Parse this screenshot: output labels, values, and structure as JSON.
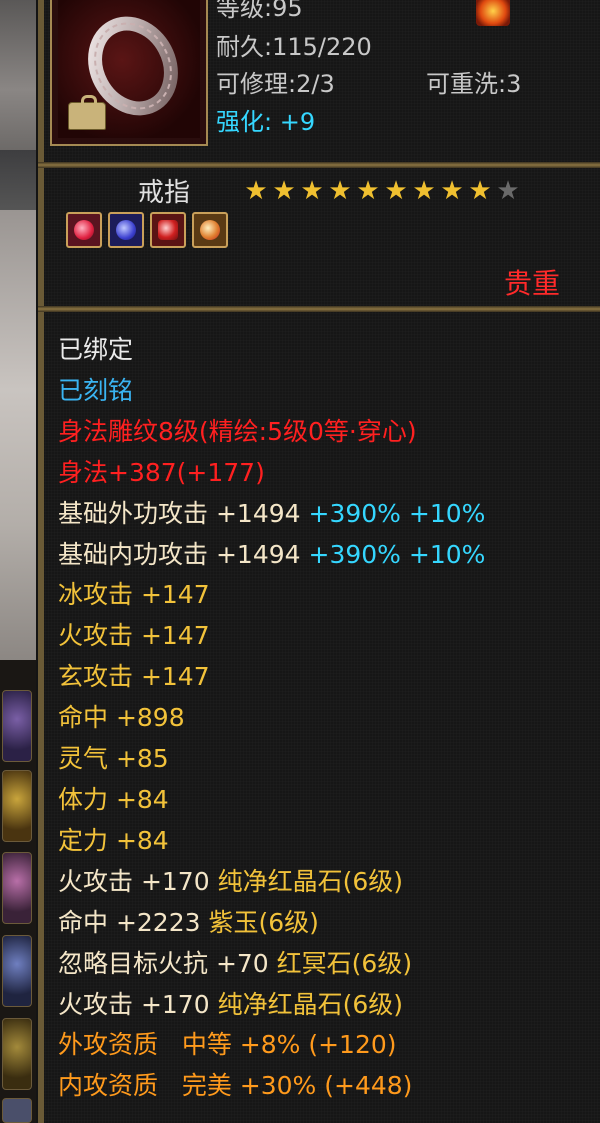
{
  "item": {
    "level_text": "等级:95",
    "durability_text": "耐久:115/220",
    "repairable_text": "可修理:2/3",
    "rewash_text": "可重洗:3",
    "enhance_label": "强化:",
    "enhance_value": "+9",
    "type": "戒指",
    "stars_filled": 9,
    "stars_total": 10,
    "gems": [
      "red",
      "blue",
      "ruby",
      "gold"
    ],
    "rarity": "贵重"
  },
  "colors": {
    "white": "#eaeaea",
    "blue": "#3ab4f2",
    "red": "#ff2020",
    "cream": "#f4e6c8",
    "cyan": "#35d7ff",
    "yellow": "#f2c23a",
    "orange": "#ff9a1c"
  },
  "attributes": {
    "bound": "已绑定",
    "engraved": "已刻铭",
    "carving": "身法雕纹8级(精绘:5级0等·穿心)",
    "agility": "身法+387(+177)",
    "base_ext_atk": {
      "label": "基础外功攻击",
      "value": "+1494",
      "pct": "+390%",
      "extra": "+10%"
    },
    "base_int_atk": {
      "label": "基础内功攻击",
      "value": "+1494",
      "pct": "+390%",
      "extra": "+10%"
    },
    "ice_atk": "冰攻击 +147",
    "fire_atk": "火攻击 +147",
    "mystic_atk": "玄攻击 +147",
    "hit": "命中 +898",
    "spirit": "灵气 +85",
    "stamina": "体力 +84",
    "focus": "定力 +84",
    "gem_line_1": {
      "stat": "火攻击 +170",
      "gem": "纯净红晶石(6级)"
    },
    "gem_line_2": {
      "stat": "命中 +2223",
      "gem": "紫玉(6级)"
    },
    "gem_line_3": {
      "stat": "忽略目标火抗 +70",
      "gem": "红冥石(6级)"
    },
    "gem_line_4": {
      "stat": "火攻击 +170",
      "gem": "纯净红晶石(6级)"
    },
    "ext_quality": "外攻资质   中等 +8% (+120)",
    "int_quality": "内攻资质   完美 +30% (+448)"
  }
}
